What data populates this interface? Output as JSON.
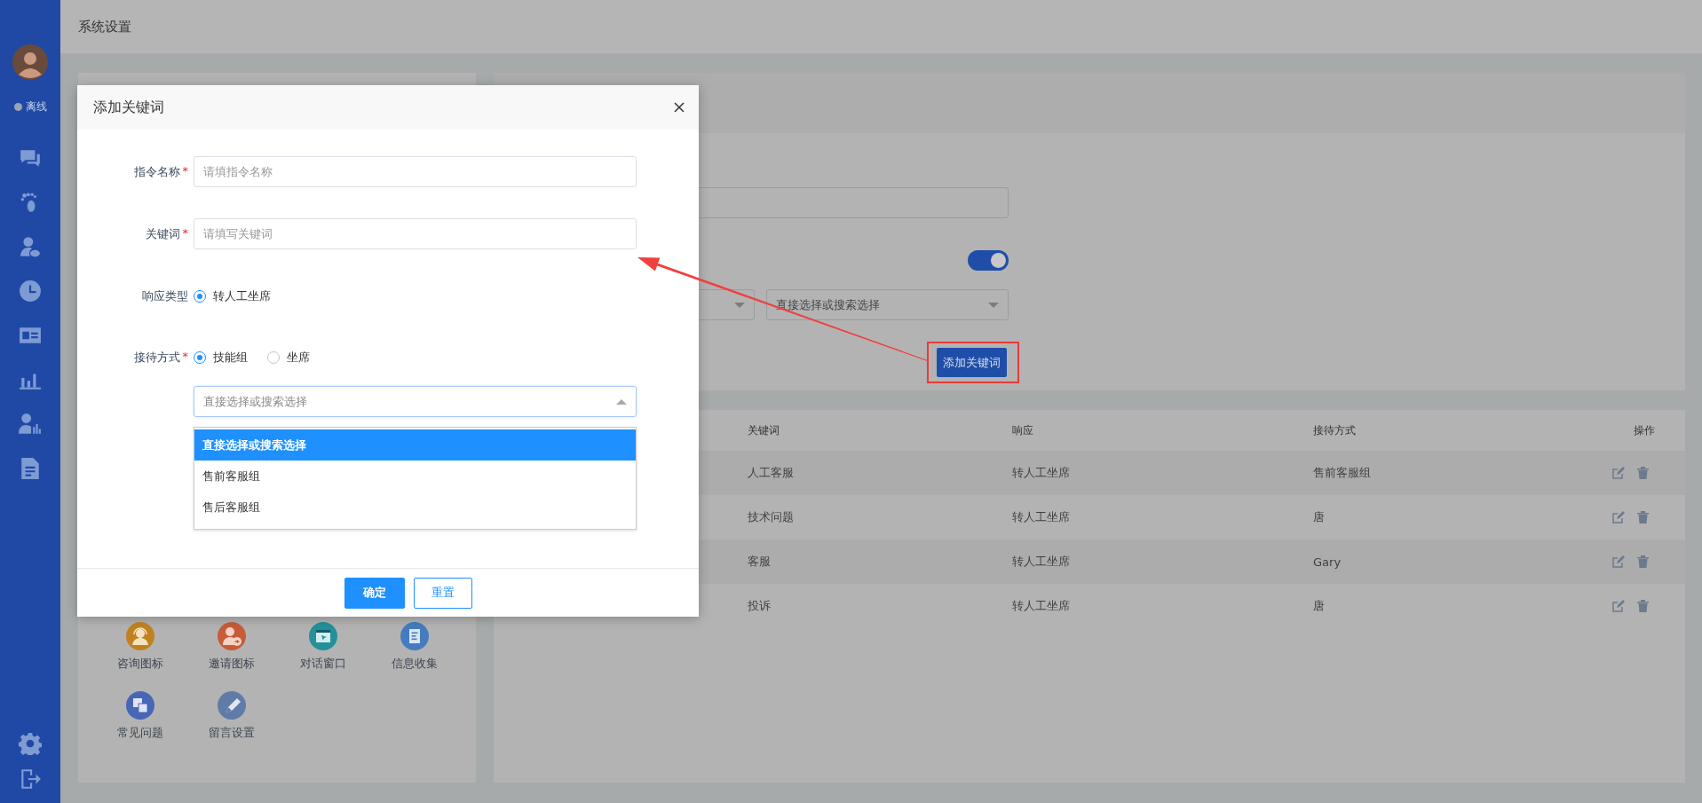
{
  "sidebar": {
    "status": "离线"
  },
  "header": {
    "title": "系统设置"
  },
  "tools": {
    "items": [
      {
        "label": "咨询图标",
        "kind": "headset",
        "color": "#c0821f"
      },
      {
        "label": "邀请图标",
        "kind": "invite",
        "color": "#c65c3a"
      },
      {
        "label": "对话窗口",
        "kind": "window",
        "color": "#23909a"
      },
      {
        "label": "信息收集",
        "kind": "form",
        "color": "#457cbf"
      },
      {
        "label": "常见问题",
        "kind": "faq",
        "color": "#4866b6"
      },
      {
        "label": "留言设置",
        "kind": "pen",
        "color": "#5f7ca8"
      }
    ]
  },
  "settings": {
    "toggle": {
      "on": true
    },
    "select": {
      "placeholder": "直接选择或搜索选择"
    },
    "add_button": "添加关键词"
  },
  "table": {
    "columns": [
      "关键词",
      "响应",
      "接待方式",
      "操作"
    ],
    "rows": [
      {
        "cells": [
          "人工客服",
          "转人工坐席",
          "售前客服组"
        ]
      },
      {
        "cells": [
          "技术问题",
          "转人工坐席",
          "唐"
        ]
      },
      {
        "cells": [
          "客服",
          "转人工坐席",
          "Gary"
        ]
      },
      {
        "cells": [
          "投诉",
          "转人工坐席",
          "唐"
        ]
      }
    ]
  },
  "dialog": {
    "title": "添加关键词",
    "fields": [
      {
        "kind": "text",
        "label": "指令名称",
        "required": "*",
        "placeholder": "请填指令名称"
      },
      {
        "kind": "text",
        "label": "关键词",
        "required": "*",
        "placeholder": "请填写关键词"
      },
      {
        "kind": "radio",
        "label": "响应类型",
        "options": [
          {
            "label": "转人工坐席",
            "selected": true
          }
        ]
      },
      {
        "kind": "radio",
        "label": "接待方式",
        "required": "*",
        "options": [
          {
            "label": "技能组",
            "selected": true
          },
          {
            "label": "坐席",
            "selected": false
          }
        ]
      },
      {
        "kind": "select",
        "placeholder": "直接选择或搜索选择",
        "expanded": true,
        "options": [
          {
            "label": "直接选择或搜索选择",
            "selected": true
          },
          {
            "label": "售前客服组",
            "selected": false
          },
          {
            "label": "售后客服组",
            "selected": false
          }
        ]
      }
    ],
    "buttons": [
      {
        "label": "确定",
        "kind": "primary"
      },
      {
        "label": "重置",
        "kind": "default"
      }
    ]
  }
}
